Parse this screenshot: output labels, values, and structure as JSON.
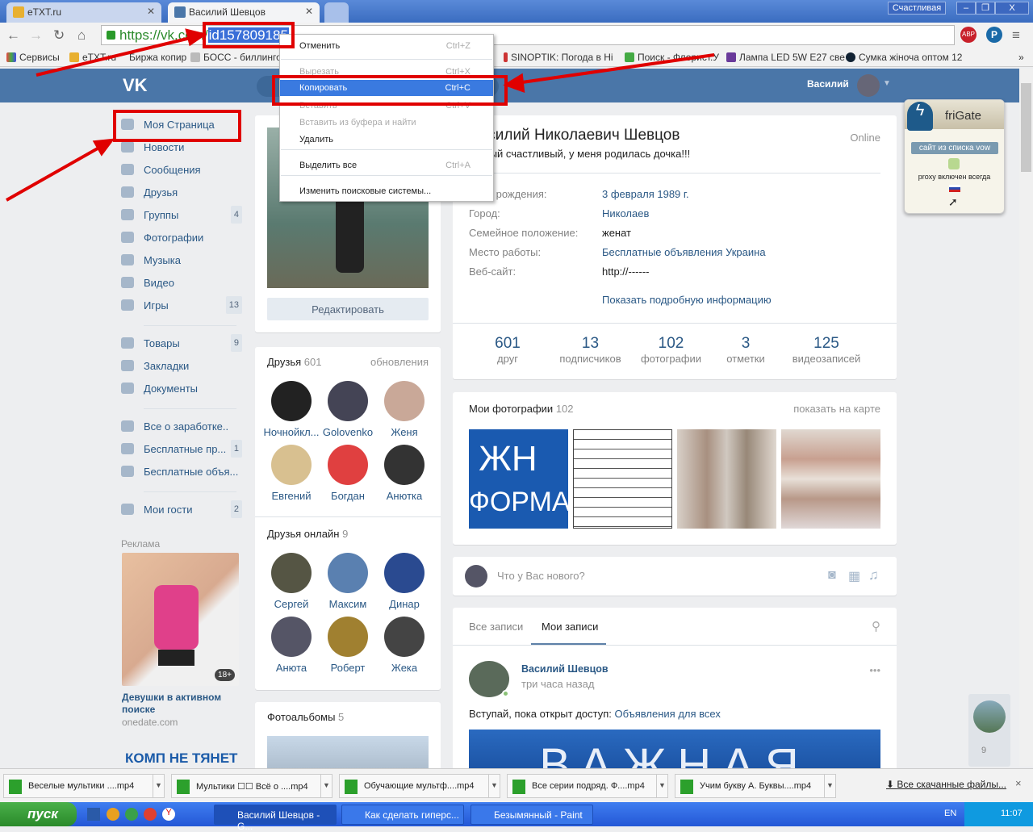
{
  "browser": {
    "tabs": [
      {
        "label": "eTXT.ru"
      },
      {
        "label": "Василий Шевцов"
      }
    ],
    "profile_name": "Счастливая",
    "url_prefix": "https://vk.com/",
    "url_selected": "id157809185",
    "bookmarks": [
      "Сервисы",
      "eTXT.ru",
      "Биржа копир",
      "БОСС - биллингов",
      "SINOPTIK: Погода в Ні",
      "Поиск - Флорист.У",
      "Лампа LED 5W E27 све",
      "Сумка жіноча оптом 12"
    ],
    "bookmarks_more": "»"
  },
  "context_menu": [
    {
      "label": "Отменить",
      "key": "Ctrl+Z"
    },
    {
      "label": "Вырезать",
      "key": "Ctrl+X"
    },
    {
      "label": "Копировать",
      "key": "Ctrl+C"
    },
    {
      "label": "Вставить",
      "key": "Ctrl+V"
    },
    {
      "label": "Вставить из буфера и найти",
      "key": ""
    },
    {
      "label": "Удалить",
      "key": ""
    },
    {
      "label": "Выделить все",
      "key": "Ctrl+A"
    },
    {
      "label": "Изменить поисковые системы...",
      "key": ""
    }
  ],
  "vk": {
    "logo": "VK",
    "user": "Василий",
    "nav": [
      {
        "label": "Моя Страница"
      },
      {
        "label": "Новости"
      },
      {
        "label": "Сообщения"
      },
      {
        "label": "Друзья"
      },
      {
        "label": "Группы",
        "count": "4"
      },
      {
        "label": "Фотографии"
      },
      {
        "label": "Музыка"
      },
      {
        "label": "Видео"
      },
      {
        "label": "Игры",
        "count": "13"
      },
      {
        "label": "Товары",
        "count": "9"
      },
      {
        "label": "Закладки"
      },
      {
        "label": "Документы"
      },
      {
        "label": "Все о заработке.."
      },
      {
        "label": "Бесплатные пр...",
        "count": "1"
      },
      {
        "label": "Бесплатные объя..."
      },
      {
        "label": "Мои гости",
        "count": "2"
      }
    ],
    "ad": {
      "heading": "Реклама",
      "badge": "18+",
      "title": "Девушки в активном поиске",
      "domain": "onedate.com",
      "banner": "КОМП НЕ ТЯНЕТ"
    },
    "edit_button": "Редактировать",
    "friends": {
      "title": "Друзья",
      "count": "601",
      "updates": "обновления",
      "items": [
        "Ночнойкл...",
        "Golovenko",
        "Женя",
        "Евгений",
        "Богдан",
        "Анютка"
      ]
    },
    "online": {
      "title": "Друзья онлайн",
      "count": "9",
      "items": [
        "Сергей",
        "Максим",
        "Динар",
        "Анюта",
        "Роберт",
        "Жека"
      ]
    },
    "albums": {
      "title": "Фотоальбомы",
      "count": "5"
    },
    "profile": {
      "name": "Василий Николаевич Шевцов",
      "status": "Самый счастливый, у меня родилась дочка!!!",
      "online": "Online",
      "fields": [
        {
          "label": "День рождения:",
          "value": "3 февраля 1989 г."
        },
        {
          "label": "Город:",
          "value": "Николаев"
        },
        {
          "label": "Семейное положение:",
          "value": "женат"
        },
        {
          "label": "Место работы:",
          "value": "Бесплатные объявления Украина"
        },
        {
          "label": "Веб-сайт:",
          "value": "http://------"
        }
      ],
      "more": "Показать подробную информацию",
      "stats": [
        {
          "n": "601",
          "l": "друг"
        },
        {
          "n": "13",
          "l": "подписчиков"
        },
        {
          "n": "102",
          "l": "фотографии"
        },
        {
          "n": "3",
          "l": "отметки"
        },
        {
          "n": "125",
          "l": "видеозаписей"
        }
      ]
    },
    "photos": {
      "title": "Мои фотографии",
      "count": "102",
      "map": "показать на карте"
    },
    "composer": {
      "placeholder": "Что у Вас нового?"
    },
    "wall": {
      "tabs": [
        "Все записи",
        "Мои записи"
      ],
      "post": {
        "author": "Василий Шевцов",
        "time": "три часа назад",
        "text": "Вступай, пока открыт доступ: ",
        "link": "Объявления для всех",
        "image_text": "ВАЖНАЯ"
      }
    },
    "side_counter": "9"
  },
  "frigate": {
    "title": "friGate",
    "site": "сайт из списка vow",
    "proxy": "proxy включен всегда"
  },
  "downloads": {
    "items": [
      "Веселые мультики ....mp4",
      "Мультики ☐☐ Всё о ....mp4",
      "Обучающие мультф....mp4",
      "Все серии подряд. Ф....mp4",
      "Учим букву А. Буквы....mp4"
    ],
    "all": "Все скачанные файлы...",
    "close": "×"
  },
  "taskbar": {
    "start": "пуск",
    "windows": [
      "Василий Шевцов - G...",
      "Как сделать гиперс...",
      "Безымянный - Paint"
    ],
    "lang": "EN",
    "time": "11:07"
  }
}
